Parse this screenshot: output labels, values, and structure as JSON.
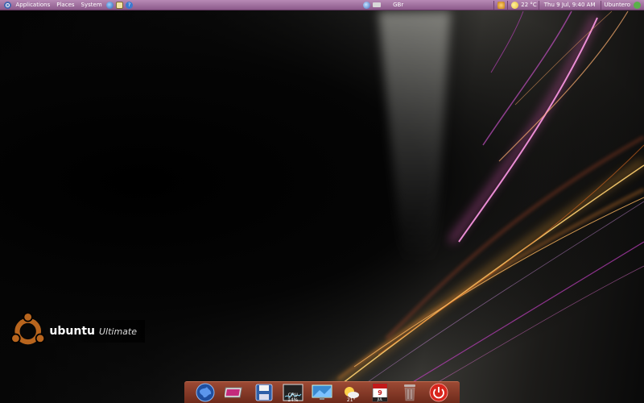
{
  "top_panel": {
    "menus": {
      "applications": "Applications",
      "places": "Places",
      "system": "System"
    },
    "keyboard_layout": "GBr",
    "weather": "22 °C",
    "clock": "Thu  9 Jul,  9:40 AM",
    "user": "Ubuntero"
  },
  "desktop": {
    "logo": {
      "brand": "ubuntu",
      "edition": "Ultimate"
    }
  },
  "dock": {
    "cpu_label": "CPU 14%",
    "weather_temp": "21°",
    "calendar_day": "9",
    "calendar_month": "JUL"
  },
  "colors": {
    "panel": "#9e6a9c",
    "dock": "#8a3b28",
    "ubuntu_orange": "#b8651e",
    "power_red": "#d8261d"
  }
}
